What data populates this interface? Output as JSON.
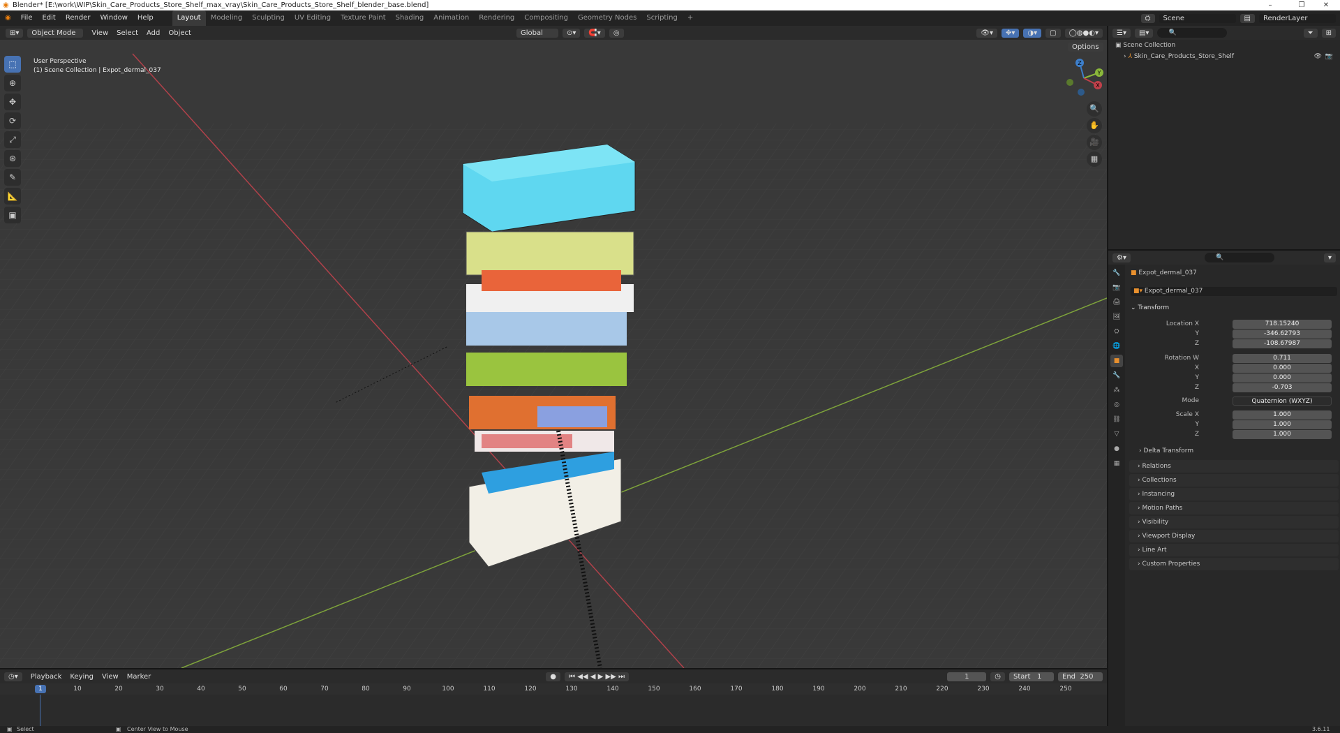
{
  "window": {
    "title": "Blender* [E:\\work\\WIP\\Skin_Care_Products_Store_Shelf_max_vray\\Skin_Care_Products_Store_Shelf_blender_base.blend]",
    "controls": [
      "–",
      "❐",
      "✕"
    ]
  },
  "menu": {
    "items": [
      "File",
      "Edit",
      "Render",
      "Window",
      "Help"
    ],
    "workspaces": [
      "Layout",
      "Modeling",
      "Sculpting",
      "UV Editing",
      "Texture Paint",
      "Shading",
      "Animation",
      "Rendering",
      "Compositing",
      "Geometry Nodes",
      "Scripting"
    ],
    "active_workspace": "Layout",
    "add_tab": "+",
    "scene": "Scene",
    "render_layer": "RenderLayer"
  },
  "viewport_header": {
    "mode": "Object Mode",
    "menus": [
      "View",
      "Select",
      "Add",
      "Object"
    ],
    "orientation": "Global",
    "options": "Options"
  },
  "viewport": {
    "perspective_label": "User Perspective",
    "context_label": "(1) Scene Collection | Expot_dermal_037",
    "gizmo_axes": [
      "Z",
      "Y",
      "X"
    ],
    "colors": {
      "x_axis": "#c1404a",
      "y_axis": "#8bb83b",
      "z_axis": "#3d7fcc",
      "grid": "#434343",
      "background": "#393939"
    }
  },
  "outliner": {
    "root": "Scene Collection",
    "items": [
      "Skin_Care_Products_Store_Shelf"
    ]
  },
  "properties": {
    "object_name": "Expot_dermal_037",
    "data_name": "Expot_dermal_037",
    "transform_label": "Transform",
    "location": {
      "label_x": "Location X",
      "label_y": "Y",
      "label_z": "Z",
      "x": "718.15240",
      "y": "-346.62793",
      "z": "-108.67987"
    },
    "rotation": {
      "label_w": "Rotation W",
      "label_x": "X",
      "label_y": "Y",
      "label_z": "Z",
      "w": "0.711",
      "x": "0.000",
      "y": "0.000",
      "z": "-0.703"
    },
    "mode": {
      "label": "Mode",
      "value": "Quaternion (WXYZ)"
    },
    "scale": {
      "label_x": "Scale X",
      "label_y": "Y",
      "label_z": "Z",
      "x": "1.000",
      "y": "1.000",
      "z": "1.000"
    },
    "delta_transform": "Delta Transform",
    "panels": [
      "Relations",
      "Collections",
      "Instancing",
      "Motion Paths",
      "Visibility",
      "Viewport Display",
      "Line Art",
      "Custom Properties"
    ]
  },
  "timeline": {
    "menus": [
      "Playback",
      "Keying",
      "View",
      "Marker"
    ],
    "current_frame": "1",
    "start_label": "Start",
    "start": "1",
    "end_label": "End",
    "end": "250",
    "ruler": [
      "10",
      "20",
      "30",
      "40",
      "50",
      "60",
      "70",
      "80",
      "90",
      "100",
      "110",
      "120",
      "130",
      "140",
      "150",
      "160",
      "170",
      "180",
      "190",
      "200",
      "210",
      "220",
      "230",
      "240",
      "250"
    ]
  },
  "statusbar": {
    "left": "Select",
    "middle": "Center View to Mouse",
    "version": "3.6.11"
  }
}
